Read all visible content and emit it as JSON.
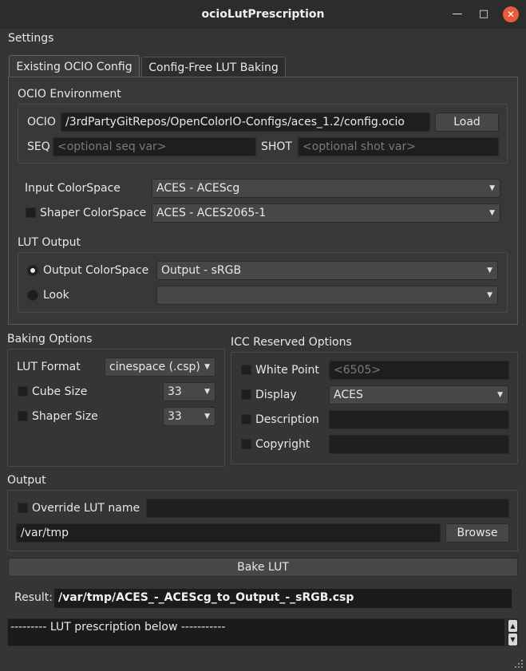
{
  "window": {
    "title": "ocioLutPrescription",
    "minimize": "—",
    "maximize": "□",
    "close": "✕"
  },
  "menu": {
    "settings": "Settings"
  },
  "tabs": [
    {
      "label": "Existing OCIO Config"
    },
    {
      "label": "Config-Free LUT Baking"
    }
  ],
  "ocio_env": {
    "title": "OCIO Environment",
    "ocio_label": "OCIO",
    "ocio_value": "/3rdPartyGitRepos/OpenColorIO-Configs/aces_1.2/config.ocio",
    "load": "Load",
    "seq_label": "SEQ",
    "seq_placeholder": "<optional seq var>",
    "shot_label": "SHOT",
    "shot_placeholder": "<optional shot var>"
  },
  "colorspaces": {
    "input_label": "Input ColorSpace",
    "input_value": "ACES - ACEScg",
    "shaper_label": "Shaper ColorSpace",
    "shaper_checked": false,
    "shaper_value": "ACES - ACES2065-1"
  },
  "lut_output": {
    "title": "LUT Output",
    "output_label": "Output ColorSpace",
    "output_selected": true,
    "output_value": "Output - sRGB",
    "look_label": "Look",
    "look_selected": false,
    "look_value": ""
  },
  "baking": {
    "title": "Baking Options",
    "format_label": "LUT Format",
    "format_value": "cinespace (.csp)",
    "cube_label": "Cube Size",
    "cube_checked": false,
    "cube_value": "33",
    "shaper_label": "Shaper Size",
    "shaper_checked": false,
    "shaper_value": "33"
  },
  "icc": {
    "title": "ICC Reserved Options",
    "white_label": "White Point",
    "white_placeholder": "<6505>",
    "display_label": "Display",
    "display_value": "ACES",
    "desc_label": "Description",
    "desc_value": "",
    "copy_label": "Copyright",
    "copy_value": ""
  },
  "output": {
    "title": "Output",
    "override_label": "Override LUT name",
    "override_checked": false,
    "override_value": "",
    "path_value": "/var/tmp",
    "browse": "Browse"
  },
  "bake_button": "Bake LUT",
  "result": {
    "label": "Result:",
    "value": "/var/tmp/ACES_-_ACEScg_to_Output_-_sRGB.csp"
  },
  "prescription": {
    "text": "--------- LUT prescription below -----------"
  },
  "scroll_up": "▲",
  "scroll_down": "▼"
}
